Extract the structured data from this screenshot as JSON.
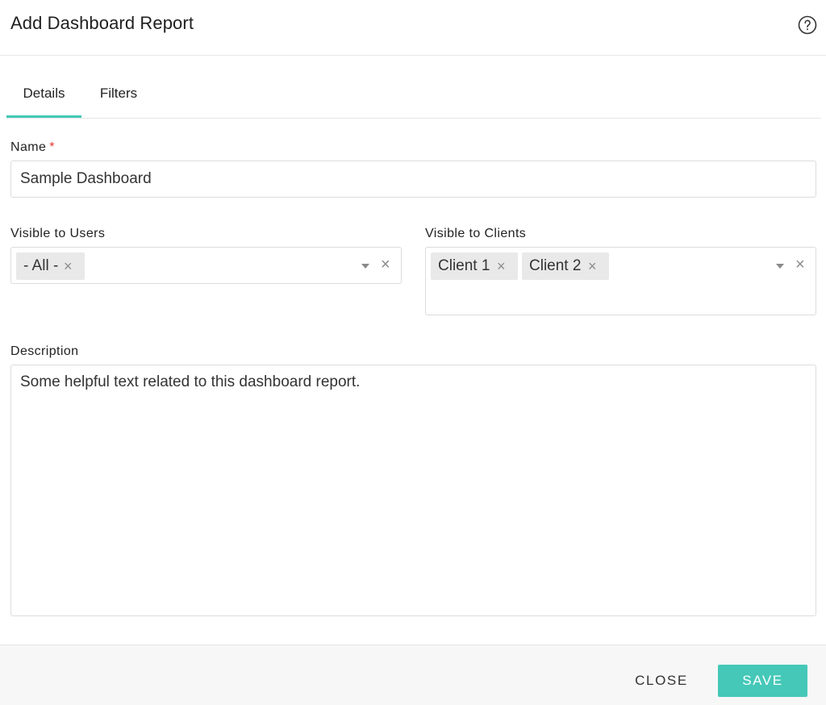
{
  "dialog": {
    "title": "Add Dashboard Report"
  },
  "tabs": [
    {
      "label": "Details",
      "active": true
    },
    {
      "label": "Filters",
      "active": false
    }
  ],
  "form": {
    "name": {
      "label": "Name",
      "required_mark": "*",
      "value": "Sample Dashboard"
    },
    "visible_to_users": {
      "label": "Visible to Users",
      "tags": [
        "- All -"
      ]
    },
    "visible_to_clients": {
      "label": "Visible to Clients",
      "tags": [
        "Client 1",
        "Client 2"
      ]
    },
    "description": {
      "label": "Description",
      "value": "Some helpful text related to this dashboard report."
    }
  },
  "icons": {
    "remove": "×",
    "clear": "×"
  },
  "footer": {
    "close_label": "CLOSE",
    "save_label": "SAVE"
  },
  "colors": {
    "accent": "#45c8b8",
    "required": "#e53935"
  }
}
